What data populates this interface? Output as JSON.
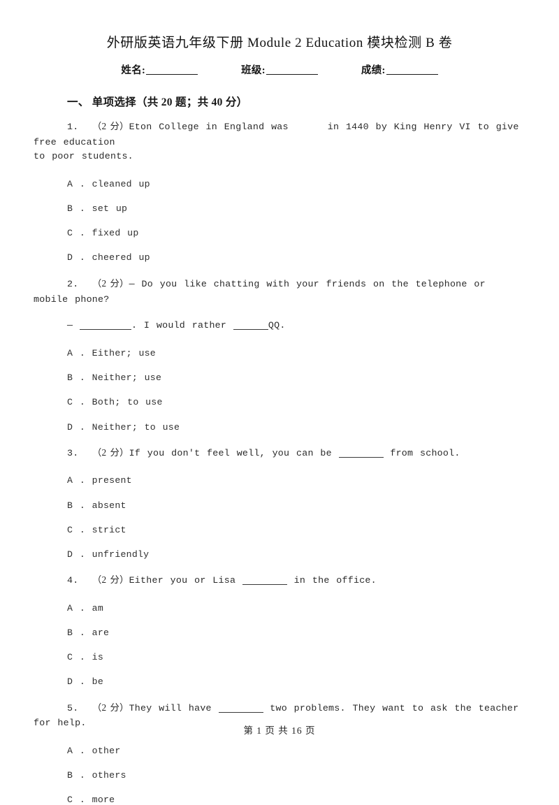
{
  "document": {
    "title": "外研版英语九年级下册 Module 2 Education 模块检测 B 卷",
    "id_fields": [
      {
        "label": "姓名:"
      },
      {
        "label": "班级:"
      },
      {
        "label": "成绩:"
      }
    ],
    "footer": "第 1 页 共 16 页"
  },
  "section": {
    "heading": "一、 单项选择（共 20 题；共 40 分）"
  },
  "questions": [
    {
      "number": "1.",
      "points": "（2 分）",
      "stem_part1": "Eton College in England was",
      "stem_part2": "in 1440 by King Henry VI to give free education",
      "stem_cont": "to poor students.",
      "options": [
        {
          "letter": "A .",
          "text": "cleaned up"
        },
        {
          "letter": "B .",
          "text": "set up"
        },
        {
          "letter": "C .",
          "text": "fixed up"
        },
        {
          "letter": "D .",
          "text": "cheered up"
        }
      ]
    },
    {
      "number": "2.",
      "points": "（2 分）",
      "stem_part1": "— Do you like chatting with your friends on the telephone or mobile phone?",
      "sub_lead": "—",
      "sub_mid": ". I would rather",
      "sub_tail": "QQ.",
      "options": [
        {
          "letter": "A .",
          "text": "Either; use"
        },
        {
          "letter": "B .",
          "text": "Neither; use"
        },
        {
          "letter": "C .",
          "text": "Both; to use"
        },
        {
          "letter": "D .",
          "text": "Neither; to use"
        }
      ]
    },
    {
      "number": "3.",
      "points": "（2 分）",
      "stem_part1": "If you don't feel well, you can be",
      "stem_part2": "from school.",
      "options": [
        {
          "letter": "A .",
          "text": "present"
        },
        {
          "letter": "B .",
          "text": "absent"
        },
        {
          "letter": "C .",
          "text": "strict"
        },
        {
          "letter": "D .",
          "text": "unfriendly"
        }
      ]
    },
    {
      "number": "4.",
      "points": "（2 分）",
      "stem_part1": "Either you or Lisa",
      "stem_part2": "in the office.",
      "options": [
        {
          "letter": "A .",
          "text": "am"
        },
        {
          "letter": "B .",
          "text": "are"
        },
        {
          "letter": "C .",
          "text": "is"
        },
        {
          "letter": "D .",
          "text": "be"
        }
      ]
    },
    {
      "number": "5.",
      "points": "（2 分）",
      "stem_part1": "They will have",
      "stem_part2": "two problems. They want to ask the teacher for help.",
      "options": [
        {
          "letter": "A .",
          "text": "other"
        },
        {
          "letter": "B .",
          "text": "others"
        },
        {
          "letter": "C .",
          "text": "more"
        }
      ]
    }
  ]
}
